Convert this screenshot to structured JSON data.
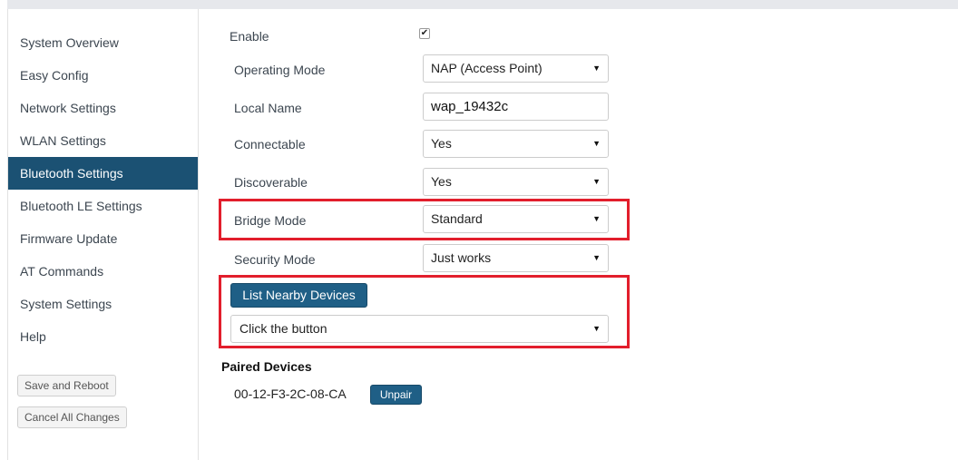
{
  "sidebar": {
    "items": [
      {
        "label": "System Overview"
      },
      {
        "label": "Easy Config"
      },
      {
        "label": "Network Settings"
      },
      {
        "label": "WLAN Settings"
      },
      {
        "label": "Bluetooth Settings"
      },
      {
        "label": "Bluetooth LE Settings"
      },
      {
        "label": "Firmware Update"
      },
      {
        "label": "AT Commands"
      },
      {
        "label": "System Settings"
      },
      {
        "label": "Help"
      }
    ],
    "active_item": "Bluetooth Settings",
    "save_reboot_label": "Save and Reboot",
    "cancel_changes_label": "Cancel All Changes"
  },
  "form": {
    "enable": {
      "label": "Enable",
      "checked": true,
      "check_glyph": "✔"
    },
    "operating_mode": {
      "label": "Operating Mode",
      "value": "NAP (Access Point)"
    },
    "local_name": {
      "label": "Local Name",
      "value": "wap_19432c"
    },
    "connectable": {
      "label": "Connectable",
      "value": "Yes"
    },
    "discoverable": {
      "label": "Discoverable",
      "value": "Yes"
    },
    "bridge_mode": {
      "label": "Bridge Mode",
      "value": "Standard"
    },
    "security_mode": {
      "label": "Security Mode",
      "value": "Just works"
    }
  },
  "nearby": {
    "button_label": "List Nearby Devices",
    "select_value": "Click the button"
  },
  "paired": {
    "title": "Paired Devices",
    "devices": [
      {
        "address": "00-12-F3-2C-08-CA",
        "unpair_label": "Unpair"
      }
    ]
  },
  "icons": {
    "dropdown_arrow": "▼",
    "dropdown_icon_name": "chevron-down-icon",
    "checkmark_icon_name": "checkmark-icon"
  },
  "colors": {
    "nav_active_bg": "#1b5173",
    "primary_button": "#1f5f86",
    "highlight_box": "#e21e2c"
  }
}
